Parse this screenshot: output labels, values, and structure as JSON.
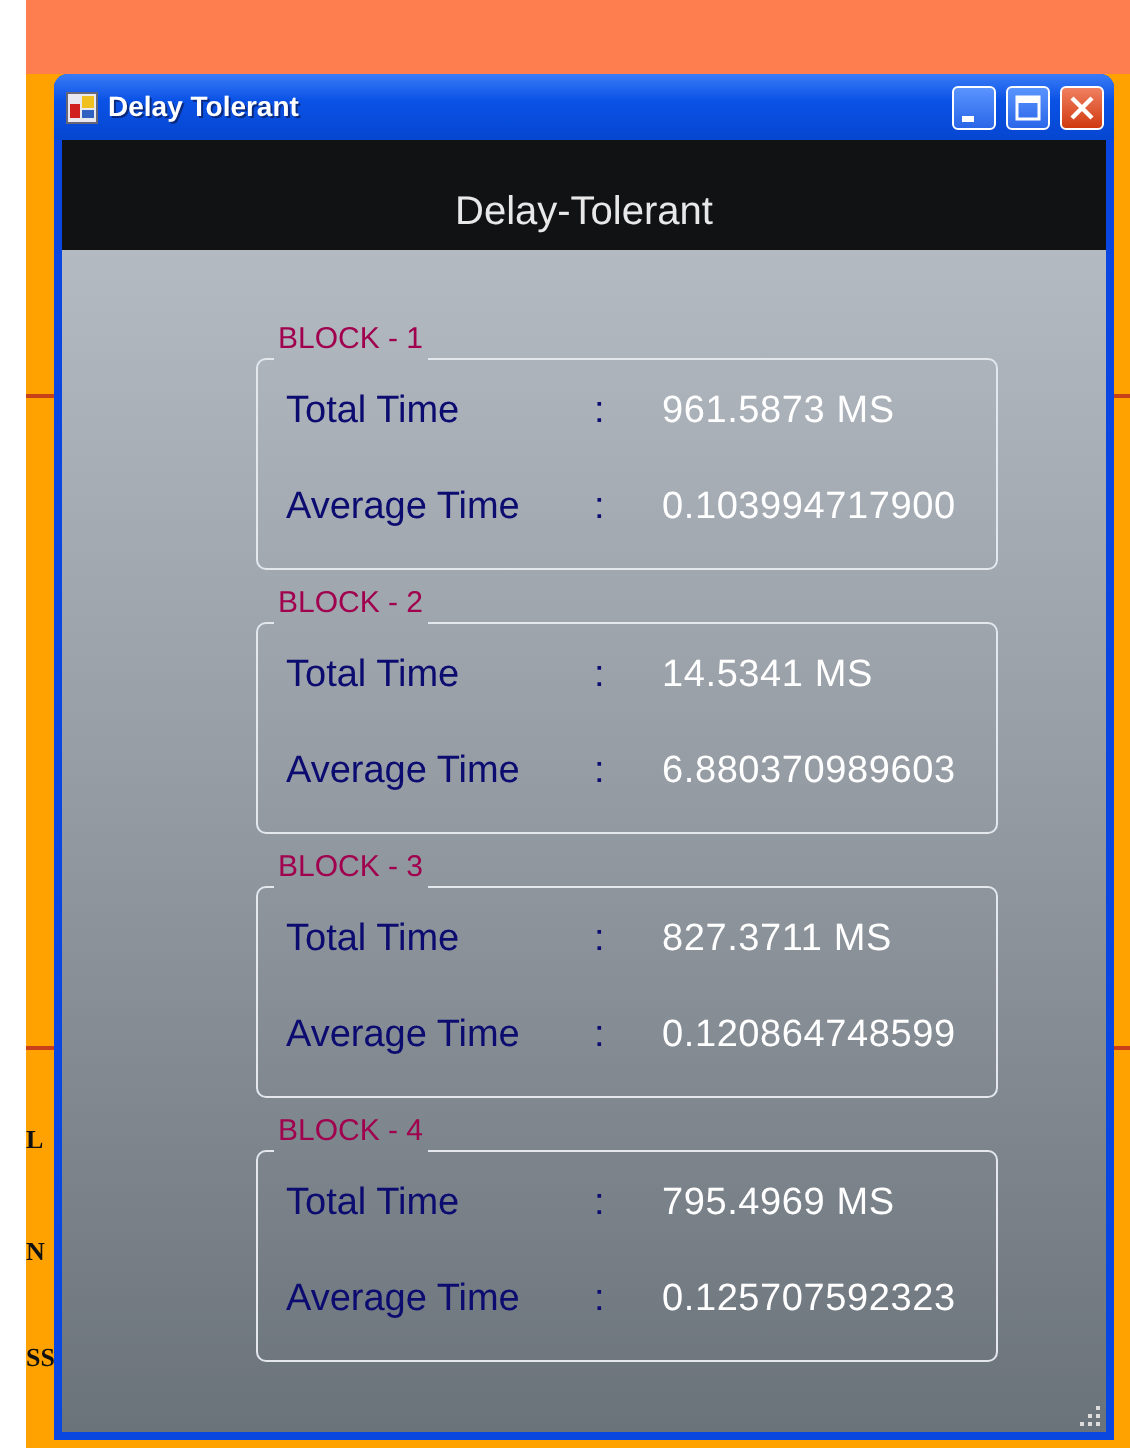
{
  "background_texts": [
    "L",
    "N",
    "SS"
  ],
  "window": {
    "title": "Delay Tolerant",
    "heading": "Delay-Tolerant"
  },
  "blocks": [
    {
      "title": "BLOCK - 1",
      "rows": [
        {
          "label": "Total Time",
          "separator": ":",
          "value": "961.5873 MS"
        },
        {
          "label": "Average Time",
          "separator": ":",
          "value": "0.103994717900"
        }
      ]
    },
    {
      "title": "BLOCK - 2",
      "rows": [
        {
          "label": "Total Time",
          "separator": ":",
          "value": "14.5341 MS"
        },
        {
          "label": "Average Time",
          "separator": ":",
          "value": "6.880370989603"
        }
      ]
    },
    {
      "title": "BLOCK - 3",
      "rows": [
        {
          "label": "Total Time",
          "separator": ":",
          "value": "827.3711 MS"
        },
        {
          "label": "Average Time",
          "separator": ":",
          "value": "0.120864748599"
        }
      ]
    },
    {
      "title": "BLOCK - 4",
      "rows": [
        {
          "label": "Total Time",
          "separator": ":",
          "value": "795.4969 MS"
        },
        {
          "label": "Average Time",
          "separator": ":",
          "value": "0.125707592323"
        }
      ]
    }
  ]
}
